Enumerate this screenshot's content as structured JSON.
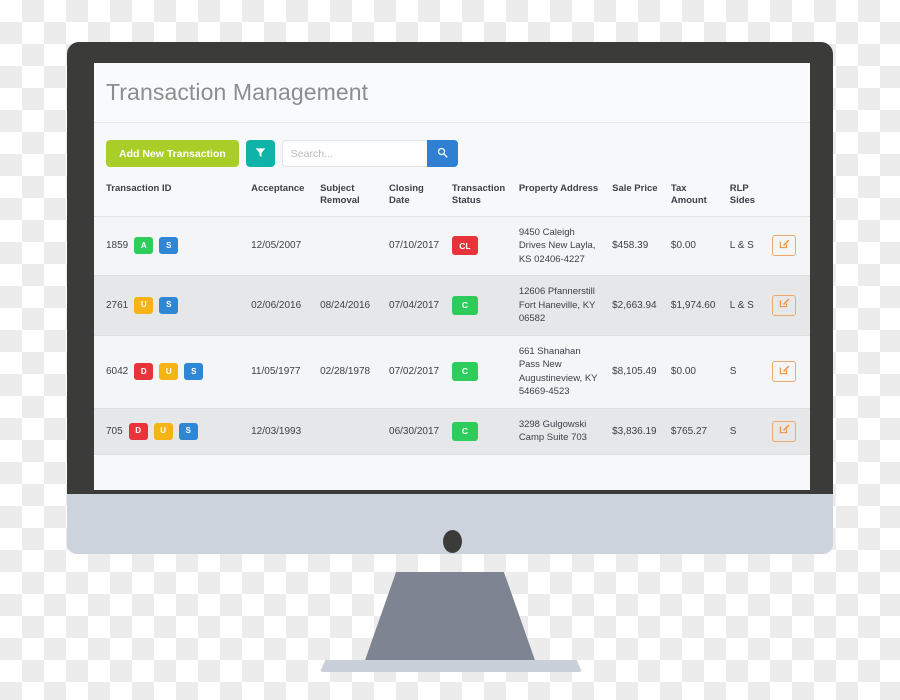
{
  "app": {
    "title": "Transaction Management"
  },
  "toolbar": {
    "add_label": "Add New Transaction",
    "filter_icon": "funnel-icon",
    "search_placeholder": "Search...",
    "search_value": "",
    "search_icon": "magnifier-icon"
  },
  "table": {
    "columns": [
      "Transaction ID",
      "Acceptance",
      "Subject Removal",
      "Closing Date",
      "Transaction Status",
      "Property Address",
      "Sale Price",
      "Tax Amount",
      "RLP Sides",
      ""
    ],
    "rows": [
      {
        "id": "1859",
        "badges": [
          {
            "label": "A",
            "color": "#2ecc5a"
          },
          {
            "label": "S",
            "color": "#2f86d4"
          }
        ],
        "acceptance": "12/05/2007",
        "subject_removal": "",
        "closing_date": "07/10/2017",
        "status": {
          "label": "CL",
          "color": "#e8333a"
        },
        "address": "9450 Caleigh Drives New Layla, KS 02406-4227",
        "sale_price": "$458.39",
        "tax_amount": "$0.00",
        "rlp_sides": "L & S",
        "action_icon": "edit-icon"
      },
      {
        "id": "2761",
        "badges": [
          {
            "label": "U",
            "color": "#f5b316"
          },
          {
            "label": "S",
            "color": "#2f86d4"
          }
        ],
        "acceptance": "02/06/2016",
        "subject_removal": "08/24/2016",
        "closing_date": "07/04/2017",
        "status": {
          "label": "C",
          "color": "#2ecc5a"
        },
        "address": "12606 Pfannerstill Fort Haneville, KY 06582",
        "sale_price": "$2,663.94",
        "tax_amount": "$1,974.60",
        "rlp_sides": "L & S",
        "action_icon": "edit-icon"
      },
      {
        "id": "6042",
        "badges": [
          {
            "label": "D",
            "color": "#e8333a"
          },
          {
            "label": "U",
            "color": "#f5b316"
          },
          {
            "label": "S",
            "color": "#2f86d4"
          }
        ],
        "acceptance": "11/05/1977",
        "subject_removal": "02/28/1978",
        "closing_date": "07/02/2017",
        "status": {
          "label": "C",
          "color": "#2ecc5a"
        },
        "address": "661 Shanahan Pass New Augustineview, KY 54669-4523",
        "sale_price": "$8,105.49",
        "tax_amount": "$0.00",
        "rlp_sides": "S",
        "action_icon": "edit-icon"
      },
      {
        "id": "705",
        "badges": [
          {
            "label": "D",
            "color": "#e8333a"
          },
          {
            "label": "U",
            "color": "#f5b316"
          },
          {
            "label": "S",
            "color": "#2f86d4"
          }
        ],
        "acceptance": "12/03/1993",
        "subject_removal": "",
        "closing_date": "06/30/2017",
        "status": {
          "label": "C",
          "color": "#2ecc5a"
        },
        "address": "3298 Gulgowski Camp Suite 703",
        "sale_price": "$3,836.19",
        "tax_amount": "$765.27",
        "rlp_sides": "S",
        "action_icon": "edit-icon"
      }
    ]
  },
  "device": {
    "type": "desktop-monitor",
    "bezel_color": "#3b3b3a",
    "chin_color": "#ccd3dc",
    "stand_color": "#7e8491"
  }
}
